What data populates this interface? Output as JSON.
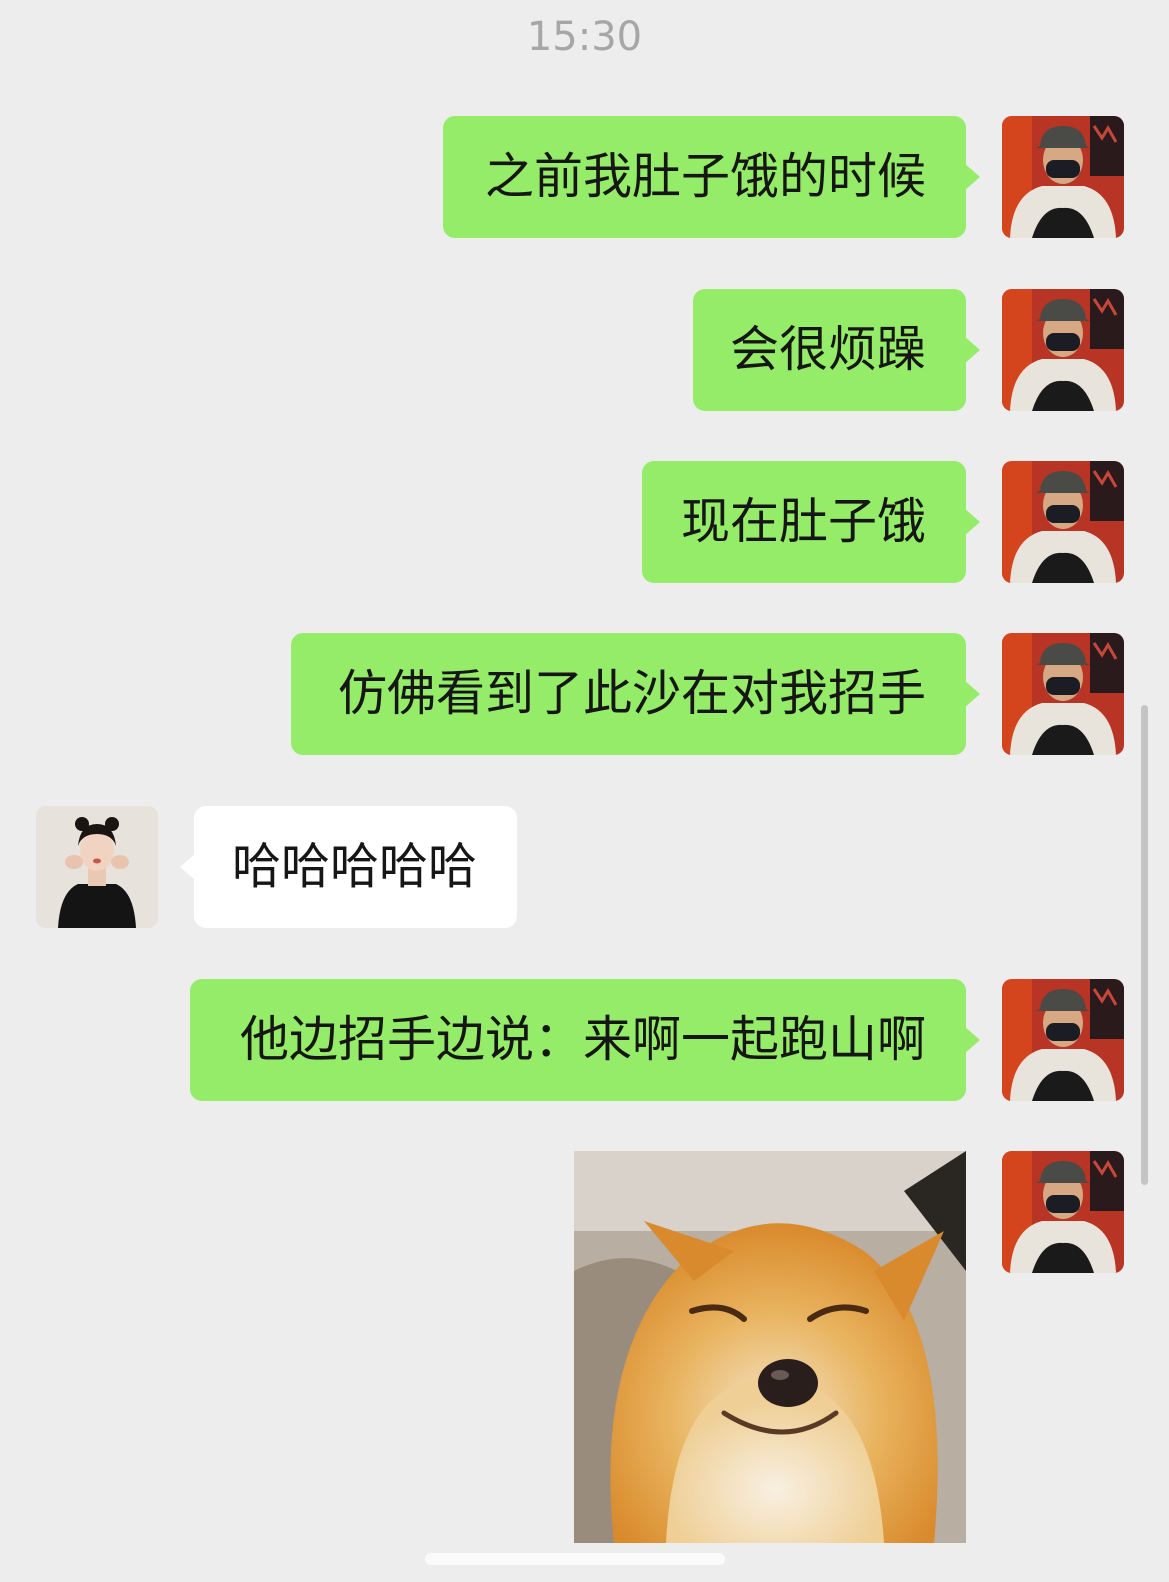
{
  "status": {
    "time": "15:30"
  },
  "messages": [
    {
      "sender": "me",
      "text": "之前我肚子饿的时候"
    },
    {
      "sender": "me",
      "text": "会很烦躁"
    },
    {
      "sender": "me",
      "text": "现在肚子饿"
    },
    {
      "sender": "me",
      "text": "仿佛看到了此沙在对我招手"
    },
    {
      "sender": "them",
      "text": "哈哈哈哈哈"
    },
    {
      "sender": "me",
      "text": "他边招手边说：来啊一起跑山啊"
    },
    {
      "sender": "me",
      "type": "sticker",
      "sticker": "smiling-shiba-dog-sticker"
    }
  ],
  "colors": {
    "background": "#ededed",
    "my_bubble": "#95ec69",
    "their_bubble": "#ffffff",
    "timestamp": "#a6a6a6"
  }
}
